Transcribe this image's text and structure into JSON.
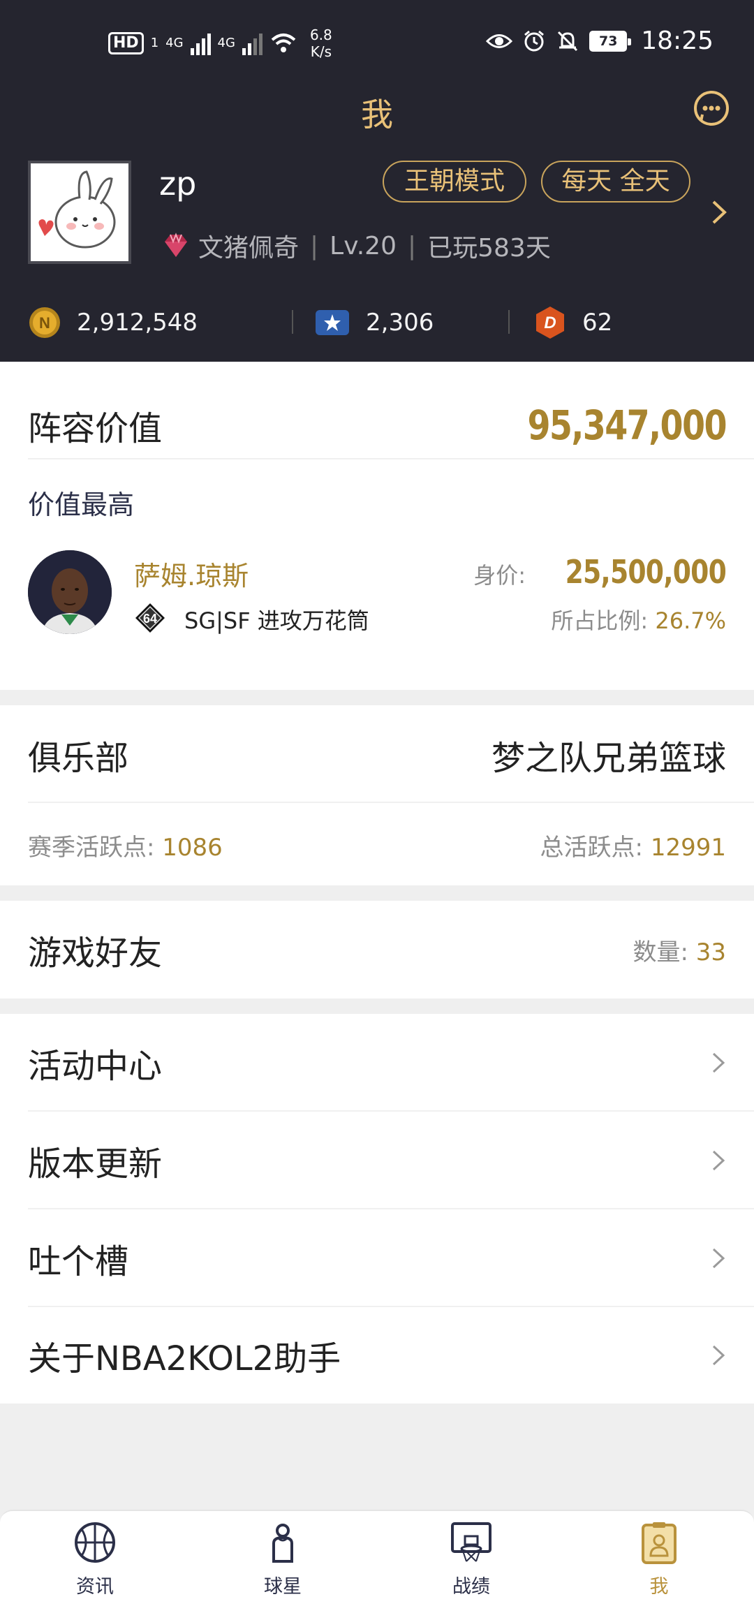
{
  "status_bar": {
    "hd": "HD",
    "sim1": "1",
    "net1": "4G",
    "net2": "4G",
    "speed_value": "6.8",
    "speed_unit": "K/s",
    "battery": "73",
    "time": "18:25"
  },
  "header": {
    "title": "我"
  },
  "profile": {
    "username": "zp",
    "mode_label": "王朝模式",
    "schedule_label": "每天 全天",
    "rank": "文猪佩奇",
    "level": "Lv.20",
    "played": "已玩583天"
  },
  "currencies": [
    {
      "icon": "gold-coin-icon",
      "value": "2,912,548"
    },
    {
      "icon": "star-badge-icon",
      "value": "2,306"
    },
    {
      "icon": "d-badge-icon",
      "value": "62"
    }
  ],
  "lineup": {
    "label": "阵容价值",
    "value": "95,347,000",
    "top_label": "价值最高",
    "player": {
      "name": "萨姆.琼斯",
      "rating": "64",
      "position": "SG|SF 进攻万花筒",
      "price_label": "身价:",
      "price": "25,500,000",
      "ratio_label": "所占比例:",
      "ratio": "26.7%"
    }
  },
  "club": {
    "label": "俱乐部",
    "name": "梦之队兄弟篮球",
    "season_label": "赛季活跃点:",
    "season_value": "1086",
    "total_label": "总活跃点:",
    "total_value": "12991"
  },
  "friends": {
    "label": "游戏好友",
    "count_label": "数量:",
    "count": "33"
  },
  "menu": [
    {
      "label": "活动中心"
    },
    {
      "label": "版本更新"
    },
    {
      "label": "吐个槽"
    },
    {
      "label": "关于NBA2KOL2助手"
    }
  ],
  "nav": [
    {
      "label": "资讯",
      "icon": "basketball-icon"
    },
    {
      "label": "球星",
      "icon": "player-icon"
    },
    {
      "label": "战绩",
      "icon": "hoop-icon"
    },
    {
      "label": "我",
      "icon": "profile-card-icon",
      "active": true
    }
  ],
  "colors": {
    "header_bg": "#25252f",
    "accent_gold": "#a8842f",
    "title_gold": "#e9c178",
    "nav_active": "#b9923c"
  }
}
